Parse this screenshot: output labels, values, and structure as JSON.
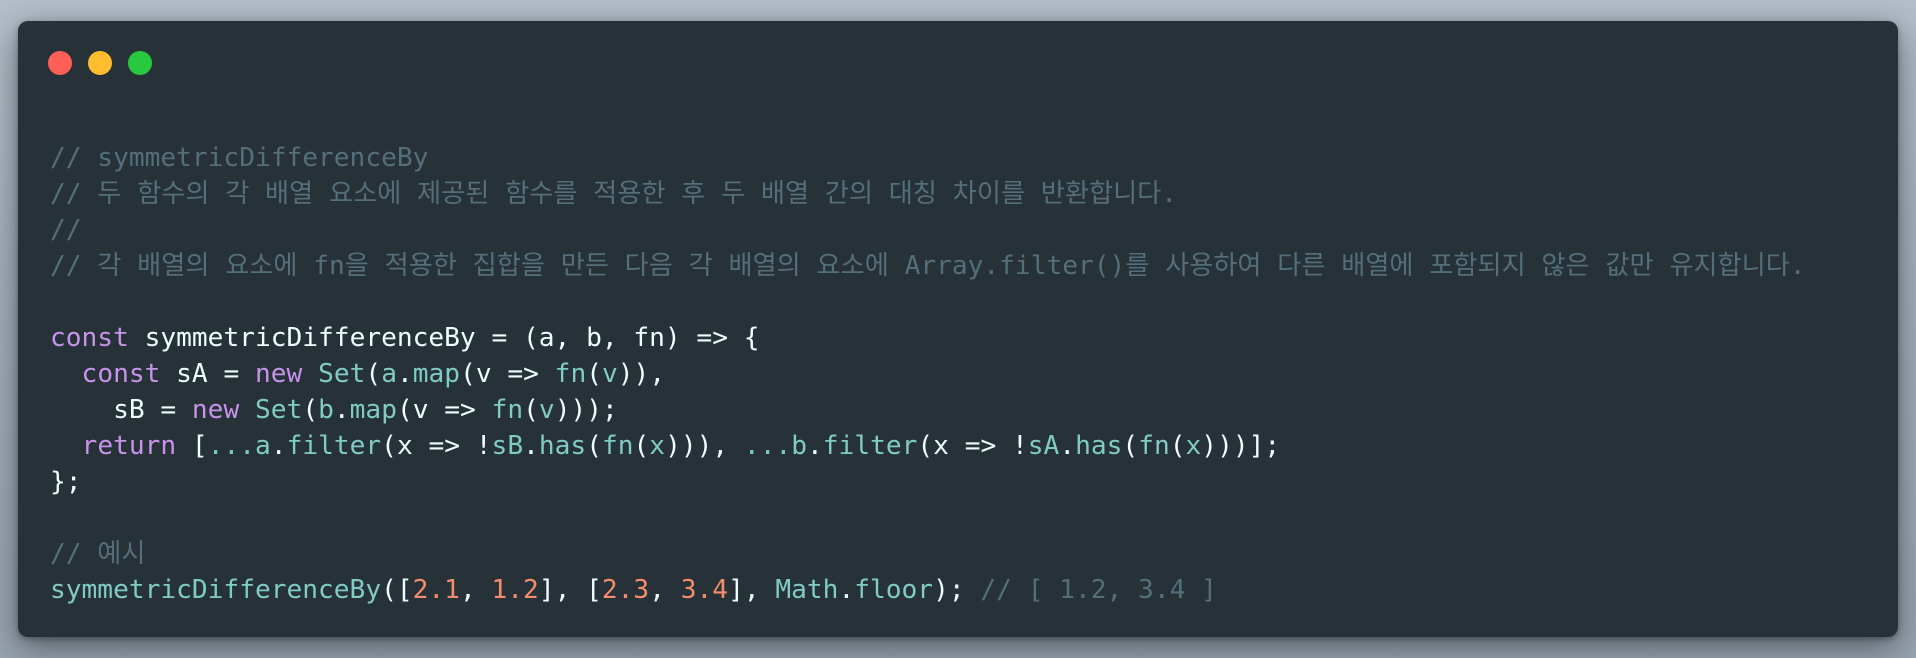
{
  "window": {
    "buttons": {
      "close": {
        "name": "close-button",
        "color": "#ff5f56"
      },
      "minimize": {
        "name": "minimize-button",
        "color": "#ffbd2e"
      },
      "maximize": {
        "name": "maximize-button",
        "color": "#27c93f"
      }
    },
    "background": "#263238"
  },
  "colors": {
    "comment": "#546e7a",
    "keyword": "#c792ea",
    "function": "#80cbc4",
    "number": "#f78c6c",
    "text": "#eeffff"
  },
  "code": {
    "lines": [
      [
        {
          "t": "comment",
          "v": "// symmetricDifferenceBy"
        }
      ],
      [
        {
          "t": "comment",
          "v": "// 두 함수의 각 배열 요소에 제공된 함수를 적용한 후 두 배열 간의 대칭 차이를 반환합니다."
        }
      ],
      [
        {
          "t": "comment",
          "v": "//"
        }
      ],
      [
        {
          "t": "comment",
          "v": "// 각 배열의 요소에 fn을 적용한 집합을 만든 다음 각 배열의 요소에 Array.filter()를 사용하여 다른 배열에 포함되지 않은 값만 유지합니다."
        }
      ],
      [],
      [
        {
          "t": "keyword",
          "v": "const"
        },
        {
          "t": "ident",
          "v": " symmetricDifferenceBy = (a, b, fn) => {"
        }
      ],
      [
        {
          "t": "ident",
          "v": "  "
        },
        {
          "t": "keyword",
          "v": "const"
        },
        {
          "t": "ident",
          "v": " sA = "
        },
        {
          "t": "keyword",
          "v": "new"
        },
        {
          "t": "ident",
          "v": " "
        },
        {
          "t": "func",
          "v": "Set"
        },
        {
          "t": "punct",
          "v": "("
        },
        {
          "t": "func",
          "v": "a"
        },
        {
          "t": "punct",
          "v": "."
        },
        {
          "t": "func",
          "v": "map"
        },
        {
          "t": "punct",
          "v": "(v => "
        },
        {
          "t": "func",
          "v": "fn"
        },
        {
          "t": "punct",
          "v": "("
        },
        {
          "t": "func",
          "v": "v"
        },
        {
          "t": "punct",
          "v": ")),"
        }
      ],
      [
        {
          "t": "ident",
          "v": "    sB = "
        },
        {
          "t": "keyword",
          "v": "new"
        },
        {
          "t": "ident",
          "v": " "
        },
        {
          "t": "func",
          "v": "Set"
        },
        {
          "t": "punct",
          "v": "("
        },
        {
          "t": "func",
          "v": "b"
        },
        {
          "t": "punct",
          "v": "."
        },
        {
          "t": "func",
          "v": "map"
        },
        {
          "t": "punct",
          "v": "(v => "
        },
        {
          "t": "func",
          "v": "fn"
        },
        {
          "t": "punct",
          "v": "("
        },
        {
          "t": "func",
          "v": "v"
        },
        {
          "t": "punct",
          "v": ")));"
        }
      ],
      [
        {
          "t": "ident",
          "v": "  "
        },
        {
          "t": "keyword",
          "v": "return"
        },
        {
          "t": "punct",
          "v": " ["
        },
        {
          "t": "func",
          "v": "...a"
        },
        {
          "t": "punct",
          "v": "."
        },
        {
          "t": "func",
          "v": "filter"
        },
        {
          "t": "punct",
          "v": "(x => !"
        },
        {
          "t": "func",
          "v": "sB"
        },
        {
          "t": "punct",
          "v": "."
        },
        {
          "t": "func",
          "v": "has"
        },
        {
          "t": "punct",
          "v": "("
        },
        {
          "t": "func",
          "v": "fn"
        },
        {
          "t": "punct",
          "v": "("
        },
        {
          "t": "func",
          "v": "x"
        },
        {
          "t": "punct",
          "v": "))), "
        },
        {
          "t": "func",
          "v": "...b"
        },
        {
          "t": "punct",
          "v": "."
        },
        {
          "t": "func",
          "v": "filter"
        },
        {
          "t": "punct",
          "v": "(x => !"
        },
        {
          "t": "func",
          "v": "sA"
        },
        {
          "t": "punct",
          "v": "."
        },
        {
          "t": "func",
          "v": "has"
        },
        {
          "t": "punct",
          "v": "("
        },
        {
          "t": "func",
          "v": "fn"
        },
        {
          "t": "punct",
          "v": "("
        },
        {
          "t": "func",
          "v": "x"
        },
        {
          "t": "punct",
          "v": ")))];"
        }
      ],
      [
        {
          "t": "punct",
          "v": "};"
        }
      ],
      [],
      [
        {
          "t": "comment",
          "v": "// 예시"
        }
      ],
      [
        {
          "t": "func",
          "v": "symmetricDifferenceBy"
        },
        {
          "t": "punct",
          "v": "(["
        },
        {
          "t": "number",
          "v": "2.1"
        },
        {
          "t": "punct",
          "v": ", "
        },
        {
          "t": "number",
          "v": "1.2"
        },
        {
          "t": "punct",
          "v": "], ["
        },
        {
          "t": "number",
          "v": "2.3"
        },
        {
          "t": "punct",
          "v": ", "
        },
        {
          "t": "number",
          "v": "3.4"
        },
        {
          "t": "punct",
          "v": "], "
        },
        {
          "t": "func",
          "v": "Math"
        },
        {
          "t": "punct",
          "v": "."
        },
        {
          "t": "func",
          "v": "floor"
        },
        {
          "t": "punct",
          "v": "); "
        },
        {
          "t": "comment",
          "v": "// [ 1.2, 3.4 ]"
        }
      ]
    ]
  }
}
